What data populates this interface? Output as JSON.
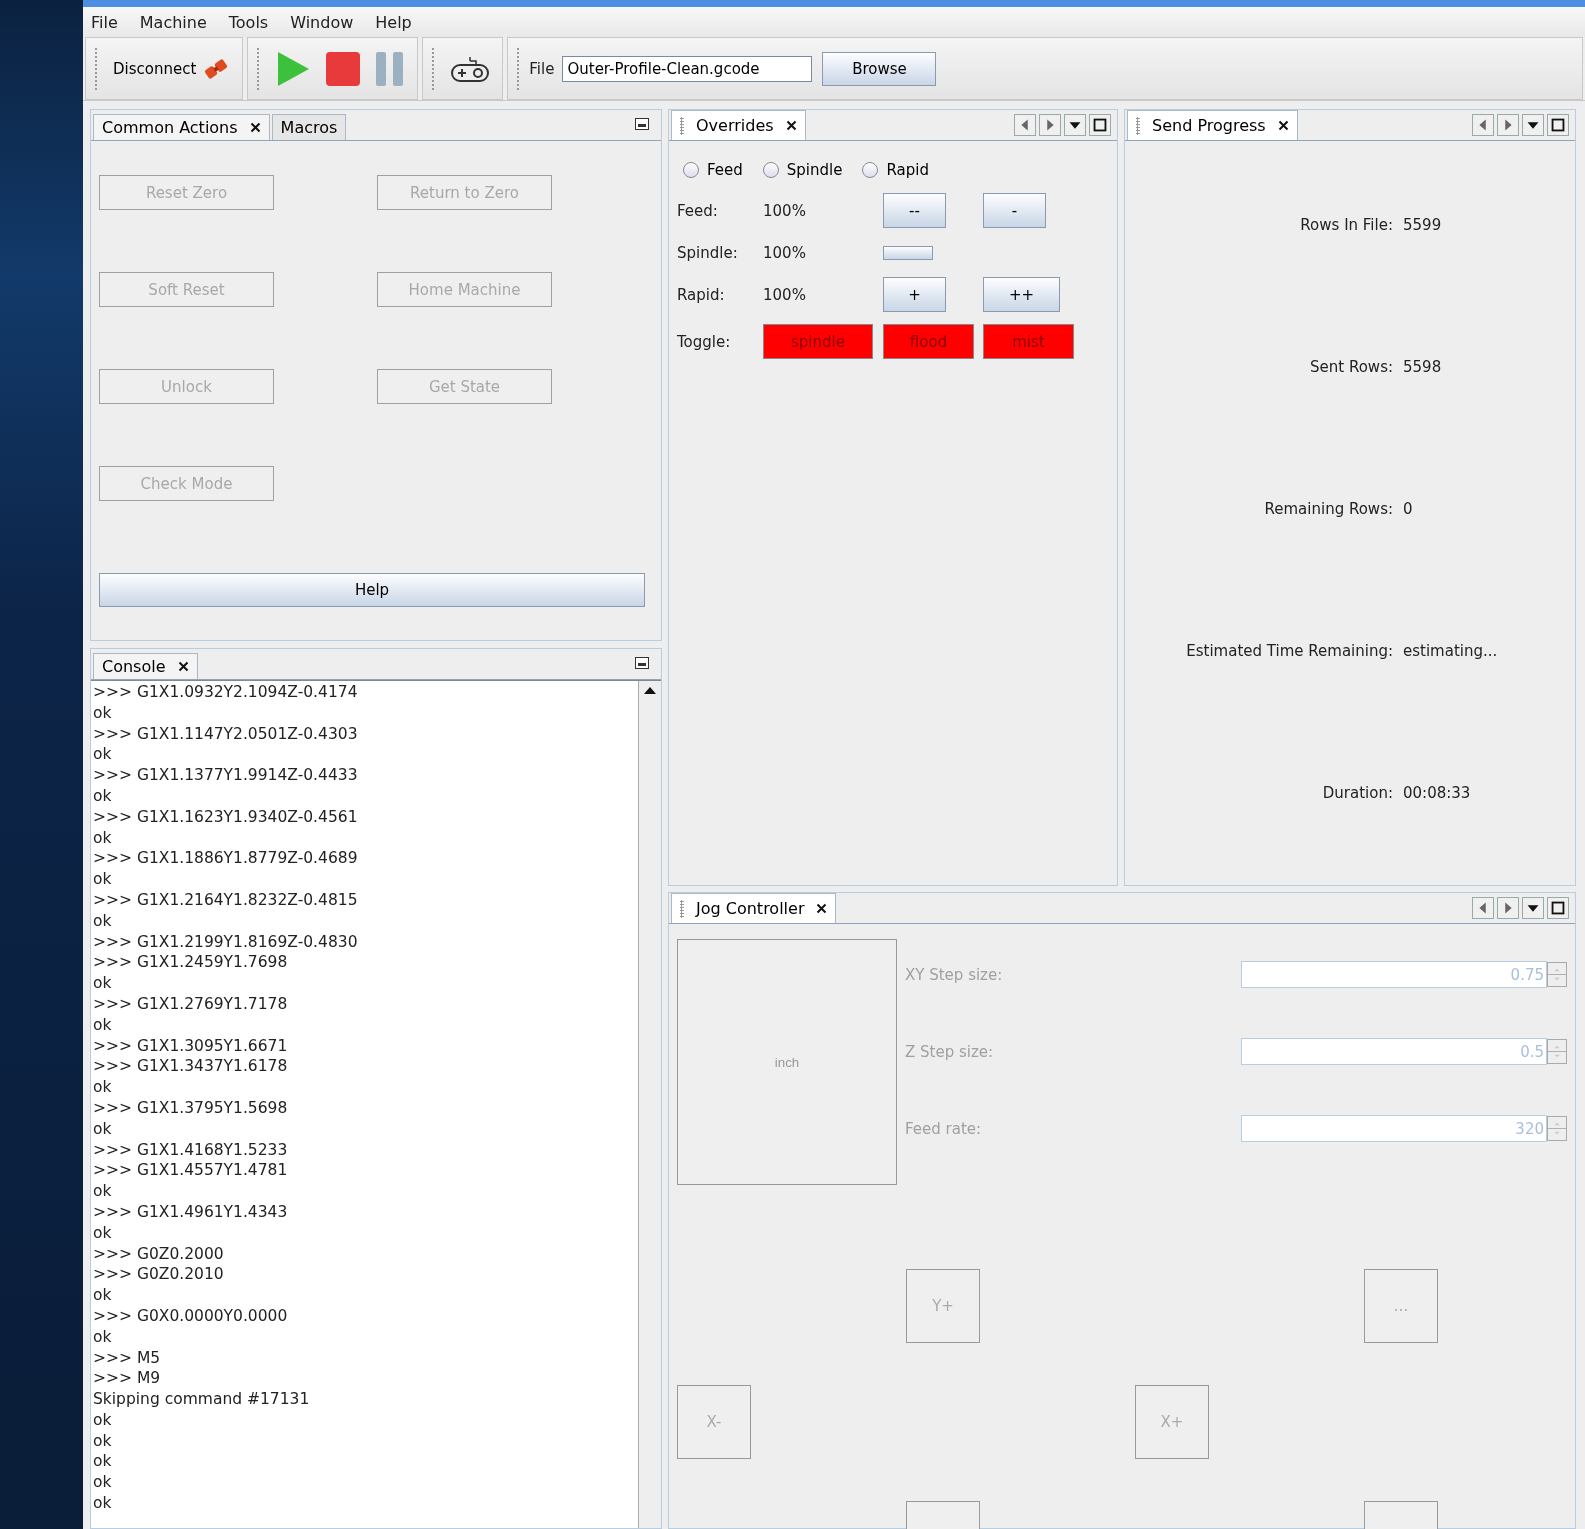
{
  "menu": [
    {
      "label": "File"
    },
    {
      "label": "Machine"
    },
    {
      "label": "Tools"
    },
    {
      "label": "Window"
    },
    {
      "label": "Help"
    }
  ],
  "toolbar": {
    "connect_label": "Disconnect",
    "file_label": "File",
    "file_value": "Outer-Profile-Clean.gcode",
    "browse_label": "Browse"
  },
  "common_actions": {
    "tabs": [
      {
        "label": "Common Actions",
        "selected": true,
        "closable": true
      },
      {
        "label": "Macros",
        "selected": false,
        "closable": false
      }
    ],
    "buttons": [
      {
        "label": "Reset Zero",
        "disabled": true
      },
      {
        "label": "Return to Zero",
        "disabled": true
      },
      {
        "label": "Soft Reset",
        "disabled": true
      },
      {
        "label": "Home Machine",
        "disabled": true
      },
      {
        "label": "Unlock",
        "disabled": true
      },
      {
        "label": "Get State",
        "disabled": true
      },
      {
        "label": "Check Mode",
        "disabled": true
      }
    ],
    "help_label": "Help"
  },
  "console": {
    "tab": "Console",
    "lines": [
      ">>> G1X1.0932Y2.1094Z-0.4174",
      "ok",
      ">>> G1X1.1147Y2.0501Z-0.4303",
      "ok",
      ">>> G1X1.1377Y1.9914Z-0.4433",
      "ok",
      ">>> G1X1.1623Y1.9340Z-0.4561",
      "ok",
      ">>> G1X1.1886Y1.8779Z-0.4689",
      "ok",
      ">>> G1X1.2164Y1.8232Z-0.4815",
      "ok",
      ">>> G1X1.2199Y1.8169Z-0.4830",
      ">>> G1X1.2459Y1.7698",
      "ok",
      ">>> G1X1.2769Y1.7178",
      "ok",
      ">>> G1X1.3095Y1.6671",
      ">>> G1X1.3437Y1.6178",
      "ok",
      ">>> G1X1.3795Y1.5698",
      "ok",
      ">>> G1X1.4168Y1.5233",
      ">>> G1X1.4557Y1.4781",
      "ok",
      ">>> G1X1.4961Y1.4343",
      "ok",
      ">>> G0Z0.2000",
      ">>> G0Z0.2010",
      "ok",
      ">>> G0X0.0000Y0.0000",
      "ok",
      ">>> M5",
      ">>> M9",
      "Skipping command #17131",
      "ok",
      "ok",
      "ok",
      "ok",
      "ok"
    ]
  },
  "overrides": {
    "tab": "Overrides",
    "radios": [
      {
        "label": "Feed",
        "selected": false
      },
      {
        "label": "Spindle",
        "selected": false
      },
      {
        "label": "Rapid",
        "selected": false
      }
    ],
    "rows": [
      {
        "label": "Feed:",
        "value": "100%",
        "buttons": [
          {
            "kind": "labeled",
            "label": "--"
          },
          {
            "kind": "labeled",
            "label": "-"
          }
        ]
      },
      {
        "label": "Spindle:",
        "value": "100%",
        "buttons": [
          {
            "kind": "blank"
          }
        ]
      },
      {
        "label": "Rapid:",
        "value": "100%",
        "buttons": [
          {
            "kind": "labeled",
            "label": "+"
          },
          {
            "kind": "labeled",
            "label": "++"
          }
        ]
      }
    ],
    "toggle_label": "Toggle:",
    "toggles": [
      {
        "label": "spindle",
        "on": false
      },
      {
        "label": "flood",
        "on": false
      },
      {
        "label": "mist",
        "on": false
      }
    ]
  },
  "send_progress": {
    "tab": "Send Progress",
    "stats": [
      {
        "label": "Rows In File:",
        "value": "5599"
      },
      {
        "label": "Sent Rows:",
        "value": "5598"
      },
      {
        "label": "Remaining Rows:",
        "value": "0"
      },
      {
        "label": "Estimated Time Remaining:",
        "value": "estimating..."
      },
      {
        "label": "Duration:",
        "value": "00:08:33"
      }
    ]
  },
  "jog_controller": {
    "tab": "Jog Controller",
    "units": "inch",
    "fields": [
      {
        "label": "XY Step size:",
        "value": "0.75"
      },
      {
        "label": "Z Step size:",
        "value": "0.5"
      },
      {
        "label": "Feed rate:",
        "value": "320"
      }
    ],
    "buttons": [
      {
        "kind": "labeled",
        "label": "Y+"
      },
      {
        "kind": "labeled",
        "label": "..."
      },
      {
        "kind": "labeled",
        "label": "X-"
      },
      {
        "kind": "labeled",
        "label": "X+"
      },
      {
        "kind": "blank"
      },
      {
        "kind": "blank"
      }
    ]
  }
}
